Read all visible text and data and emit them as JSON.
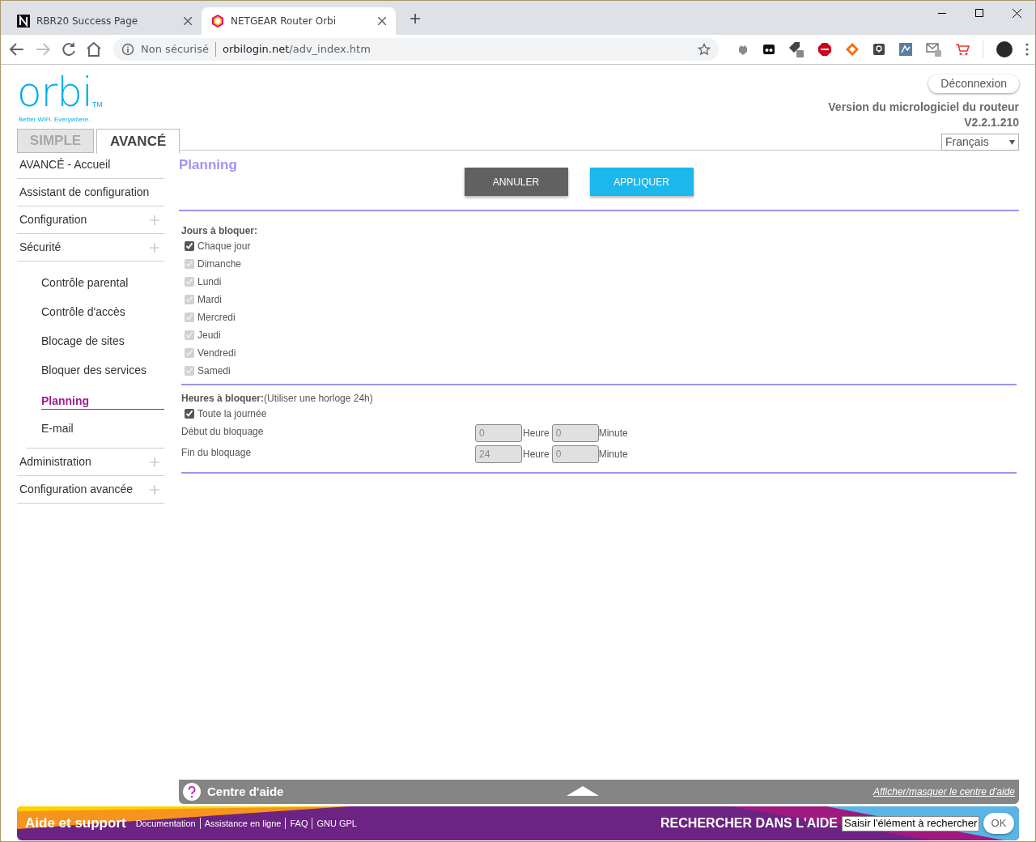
{
  "browser": {
    "tabs": [
      {
        "title": "RBR20 Success Page",
        "selected": false
      },
      {
        "title": "NETGEAR Router Orbi",
        "selected": true
      }
    ],
    "address": {
      "security": "Non sécurisé",
      "host": "orbilogin.net",
      "path": "/adv_index.htm"
    }
  },
  "header": {
    "logo": "orbi",
    "logo_mark": "TM",
    "tagline": "Better WiFi. Everywhere.",
    "logout": "Déconnexion",
    "firmware_label": "Version du micrologiciel du routeur",
    "firmware_version": "V2.2.1.210",
    "language": "Français"
  },
  "mode_tabs": [
    {
      "label": "SIMPLE",
      "selected": false
    },
    {
      "label": "AVANCÉ",
      "selected": true
    }
  ],
  "sidebar": [
    {
      "label": "AVANCÉ - Accueil",
      "kind": "link"
    },
    {
      "label": "Assistant de configuration",
      "kind": "link"
    },
    {
      "label": "Configuration",
      "kind": "section"
    },
    {
      "label": "Sécurité",
      "kind": "section",
      "children": [
        {
          "label": "Contrôle parental",
          "selected": false
        },
        {
          "label": "Contrôle d'accès",
          "selected": false
        },
        {
          "label": "Blocage de sites",
          "selected": false
        },
        {
          "label": "Bloquer des services",
          "selected": false
        },
        {
          "label": "Planning",
          "selected": true
        },
        {
          "label": "E-mail",
          "selected": false
        }
      ]
    },
    {
      "label": "Administration",
      "kind": "section"
    },
    {
      "label": "Configuration avancée",
      "kind": "section"
    }
  ],
  "page": {
    "title": "Planning",
    "buttons": [
      {
        "label": "ANNULER",
        "kind": "secondary"
      },
      {
        "label": "APPLIQUER",
        "kind": "primary"
      }
    ],
    "days": {
      "label": "Jours à bloquer:",
      "options": [
        {
          "label": "Chaque jour",
          "checked": true,
          "disabled": false
        },
        {
          "label": "Dimanche",
          "checked": true,
          "disabled": true
        },
        {
          "label": "Lundi",
          "checked": true,
          "disabled": true
        },
        {
          "label": "Mardi",
          "checked": true,
          "disabled": true
        },
        {
          "label": "Mercredi",
          "checked": true,
          "disabled": true
        },
        {
          "label": "Jeudi",
          "checked": true,
          "disabled": true
        },
        {
          "label": "Vendredi",
          "checked": true,
          "disabled": true
        },
        {
          "label": "Samedi",
          "checked": true,
          "disabled": true
        }
      ]
    },
    "hours": {
      "label": "Heures à bloquer:",
      "note": "(Utiliser une horloge 24h)",
      "all_day": {
        "label": "Toute la journée",
        "checked": true
      },
      "rows": [
        {
          "label": "Début du bloquage",
          "hour": "0",
          "hour_unit": "Heure",
          "minute": "0",
          "minute_unit": "Minute",
          "disabled": true
        },
        {
          "label": "Fin du bloquage",
          "hour": "24",
          "hour_unit": "Heure",
          "minute": "0",
          "minute_unit": "Minute",
          "disabled": true
        }
      ]
    }
  },
  "help_bar": {
    "title": "Centre d'aide",
    "toggle": "Afficher/masquer le centre d'aide"
  },
  "footer": {
    "title": "Aide et support",
    "links": [
      "Documentation",
      "Assistance en ligne",
      "FAQ",
      "GNU GPL"
    ],
    "search_label": "RECHERCHER DANS L'AIDE",
    "search_placeholder": "Saisir l'élément à rechercher",
    "ok": "OK"
  }
}
